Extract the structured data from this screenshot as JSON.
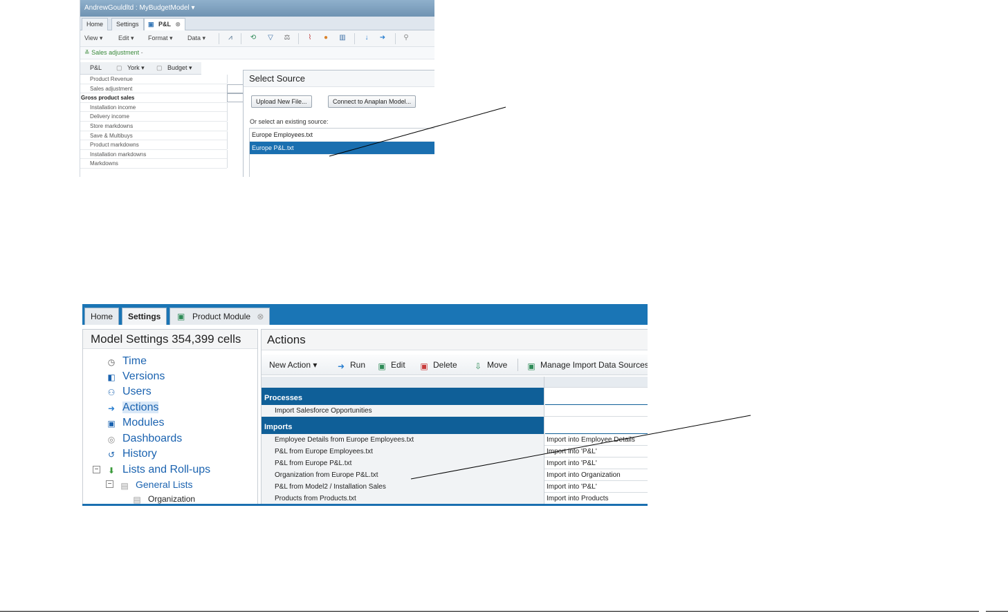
{
  "shot1": {
    "title": "AndrewGouldltd : MyBudgetModel ▾",
    "tabs": [
      "Home",
      "Settings",
      "P&L"
    ],
    "toolbar": {
      "view": "View ▾",
      "edit": "Edit ▾",
      "format": "Format ▾",
      "data": "Data ▾"
    },
    "filter": "Sales adjustment",
    "context": {
      "module": "P&L",
      "york": "York ▾",
      "budget": "Budget ▾"
    },
    "rows": [
      "Product Revenue",
      "Sales adjustment",
      "Gross product sales",
      "Installation income",
      "Delivery income",
      "Store markdowns",
      "Save & Multibuys",
      "Product markdowns",
      "Installation markdowns",
      "Markdowns"
    ],
    "dialog": {
      "title": "Select Source",
      "upload_button": "Upload New File...",
      "connect_button": "Connect to Anaplan Model...",
      "prompt": "Or select an existing source:",
      "sources": [
        "Europe Employees.txt",
        "Europe P&L.txt"
      ]
    }
  },
  "shot2": {
    "tabs": [
      "Home",
      "Settings",
      "Product Module"
    ],
    "left_title": "Model Settings 354,399 cells",
    "tree": [
      "Time",
      "Versions",
      "Users",
      "Actions",
      "Modules",
      "Dashboards",
      "History",
      "Lists and Roll-ups",
      "General Lists",
      "Organization"
    ],
    "right_title": "Actions",
    "toolbar": {
      "new_action": "New Action ▾",
      "run": "Run",
      "edit": "Edit",
      "delete": "Delete",
      "move": "Move",
      "manage": "Manage Import Data Sources"
    },
    "sections": {
      "processes": "Processes",
      "imports": "Imports"
    },
    "process_rows": [
      {
        "name": "Import Salesforce Opportunities",
        "desc": ""
      }
    ],
    "import_rows": [
      {
        "name": "Employee Details from Europe Employees.txt",
        "desc": "Import into Employee Details"
      },
      {
        "name": "P&L from Europe Employees.txt",
        "desc": "Import into 'P&L'"
      },
      {
        "name": "P&L from Europe P&L.txt",
        "desc": "Import into 'P&L'"
      },
      {
        "name": "Organization from Europe P&L.txt",
        "desc": "Import into Organization"
      },
      {
        "name": "P&L from Model2 / Installation Sales",
        "desc": "Import into 'P&L'"
      },
      {
        "name": "Products from Products.txt",
        "desc": "Import into Products"
      }
    ]
  },
  "colors": {
    "accent_blue": "#1a75b5",
    "section_blue": "#0f5f98",
    "selection_blue": "#1a6fb0",
    "link_blue": "#1b63b0"
  }
}
